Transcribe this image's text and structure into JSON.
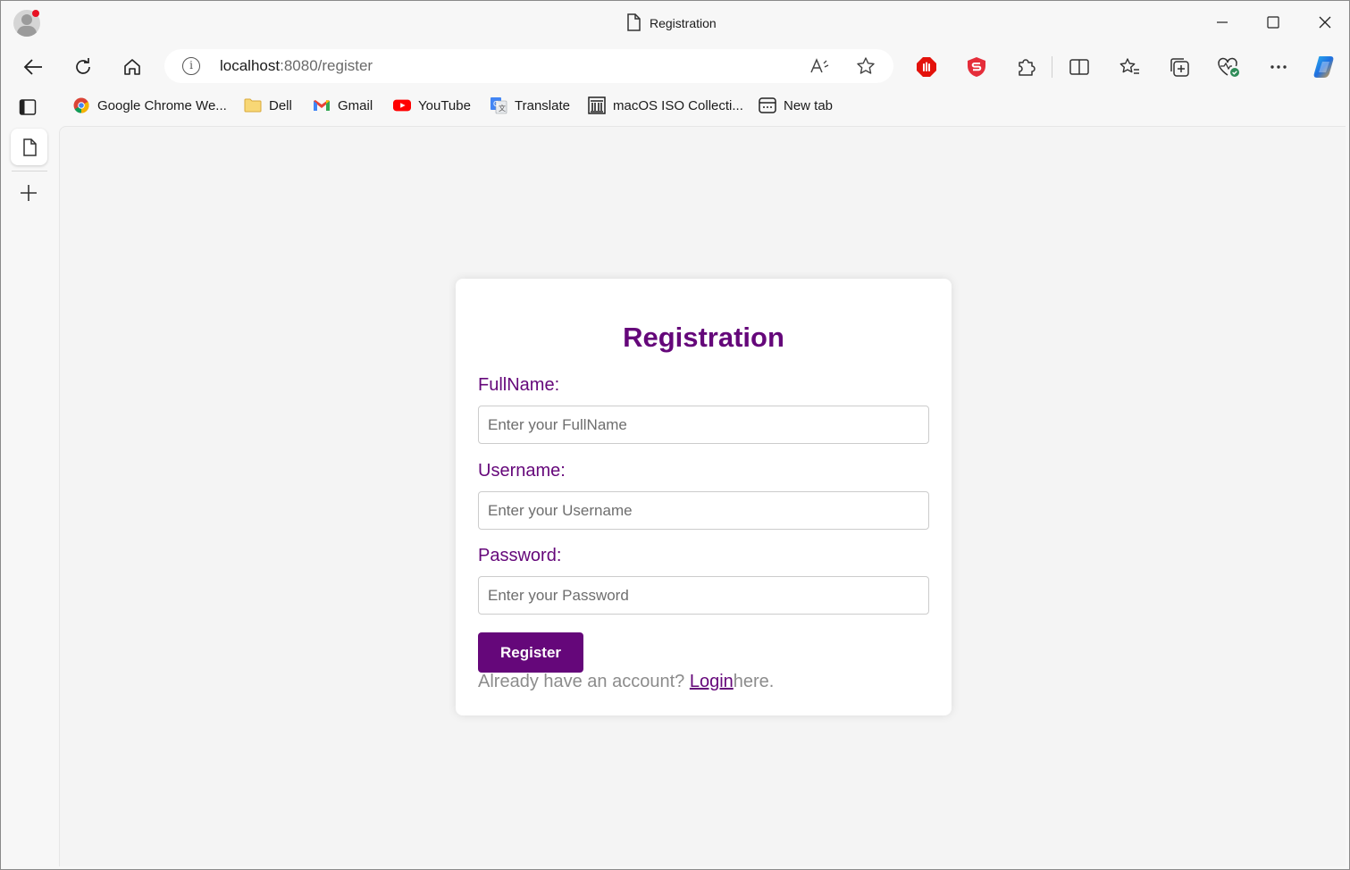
{
  "window": {
    "tab_title": "Registration"
  },
  "addressbar": {
    "url_host": "localhost",
    "url_rest": ":8080/register"
  },
  "bookmarks": [
    {
      "label": "Google Chrome We...",
      "icon": "chrome-icon"
    },
    {
      "label": "Dell",
      "icon": "folder-icon"
    },
    {
      "label": "Gmail",
      "icon": "gmail-icon"
    },
    {
      "label": "YouTube",
      "icon": "youtube-icon"
    },
    {
      "label": "Translate",
      "icon": "translate-icon"
    },
    {
      "label": "macOS ISO Collecti...",
      "icon": "archive-icon"
    },
    {
      "label": "New tab",
      "icon": "new-tab-icon"
    }
  ],
  "form": {
    "title": "Registration",
    "fullname_label": "FullName:",
    "fullname_placeholder": "Enter your FullName",
    "username_label": "Username:",
    "username_placeholder": "Enter your Username",
    "password_label": "Password:",
    "password_placeholder": "Enter your Password",
    "submit_label": "Register",
    "login_prefix": "Already have an account? ",
    "login_link": "Login",
    "login_suffix": "here."
  },
  "colors": {
    "accent": "#65077a",
    "muted_text": "#8c8c8c",
    "page_background": "#f4f4f4"
  }
}
